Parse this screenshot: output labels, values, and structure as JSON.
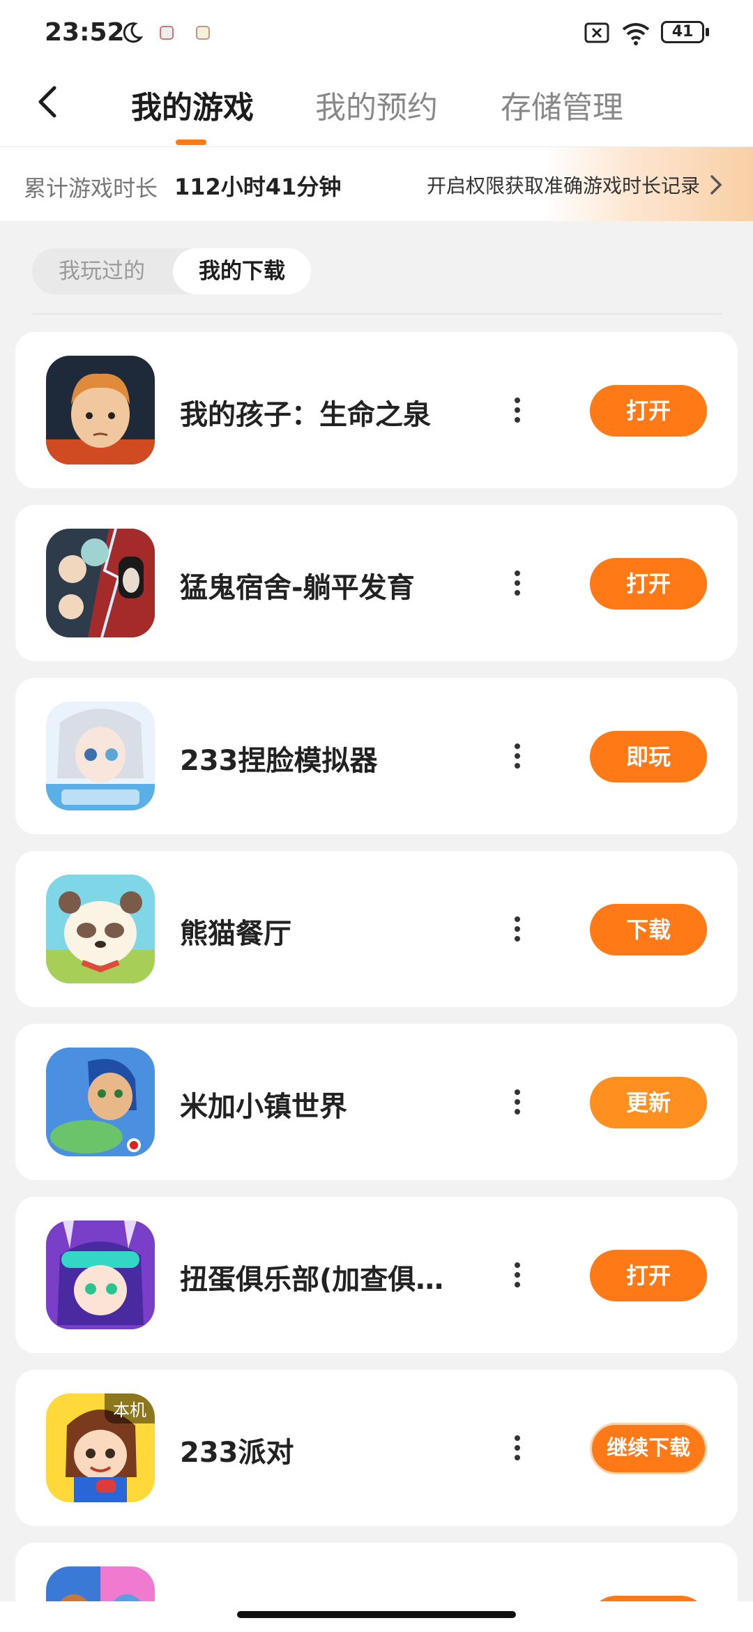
{
  "status_bar": {
    "time": "23:52",
    "battery": "41"
  },
  "nav": {
    "tabs": [
      {
        "label": "我的游戏",
        "active": true
      },
      {
        "label": "我的预约",
        "active": false
      },
      {
        "label": "存储管理",
        "active": false
      }
    ],
    "accent_color": "#ff7a17"
  },
  "playtime_banner": {
    "label": "累计游戏时长",
    "value": "112小时41分钟",
    "link": "开启权限获取准确游戏时长记录"
  },
  "segment": {
    "items": [
      {
        "label": "我玩过的",
        "active": false
      },
      {
        "label": "我的下载",
        "active": true
      }
    ]
  },
  "games": [
    {
      "name": "我的孩子：生命之泉",
      "action": "打开",
      "icon": "boy-portrait-icon"
    },
    {
      "name": "猛鬼宿舍-躺平发育",
      "action": "打开",
      "icon": "ghost-dorm-icon"
    },
    {
      "name": "233捏脸模拟器",
      "action": "即玩",
      "icon": "anime-girl-icon"
    },
    {
      "name": "熊猫餐厅",
      "action": "下载",
      "icon": "panda-icon"
    },
    {
      "name": "米加小镇世界",
      "action": "更新",
      "icon": "miga-town-icon"
    },
    {
      "name": "扭蛋俱乐部(加查俱…",
      "action": "打开",
      "icon": "gacha-girl-icon"
    },
    {
      "name": "233派对",
      "action": "继续下载",
      "icon": "party-kid-icon",
      "badge": "本机"
    }
  ]
}
